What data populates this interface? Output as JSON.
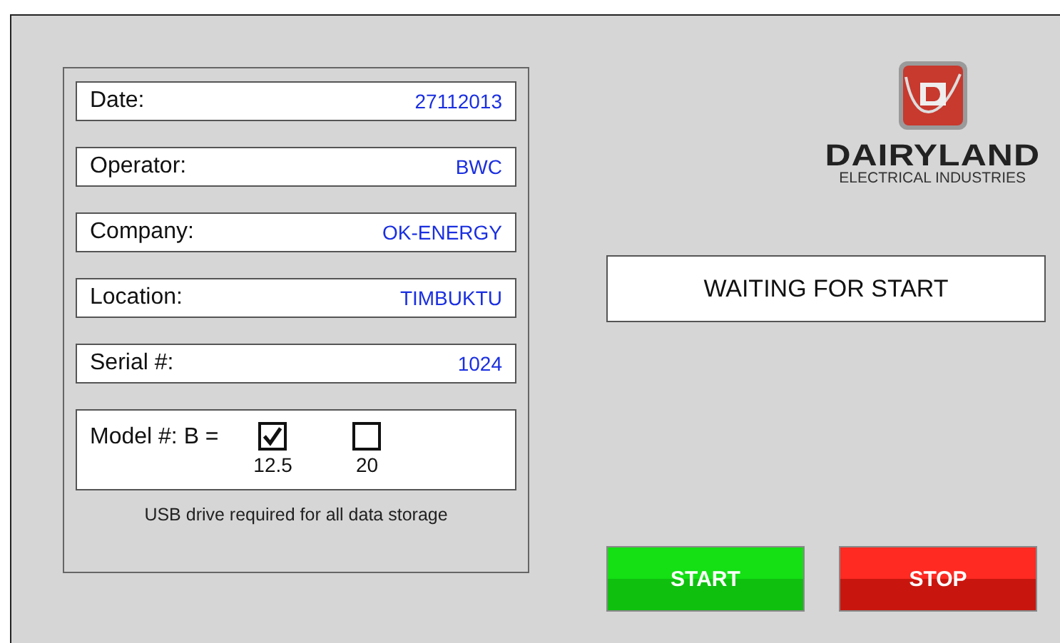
{
  "fields": [
    {
      "label": "Date:",
      "value": "27112013"
    },
    {
      "label": "Operator:",
      "value": "BWC"
    },
    {
      "label": "Company:",
      "value": "OK-ENERGY"
    },
    {
      "label": "Location:",
      "value": "TIMBUKTU"
    },
    {
      "label": "Serial #:",
      "value": "1024"
    }
  ],
  "model": {
    "label": "Model #: B =",
    "options": [
      {
        "label": "12.5",
        "checked": true
      },
      {
        "label": "20",
        "checked": false
      }
    ]
  },
  "note": "USB drive required for all data storage",
  "logo": {
    "name": "DAIRYLAND",
    "tagline": "ELECTRICAL INDUSTRIES"
  },
  "status": "WAITING FOR START",
  "buttons": [
    {
      "label": "START",
      "kind": "start"
    },
    {
      "label": "STOP",
      "kind": "stop"
    }
  ]
}
